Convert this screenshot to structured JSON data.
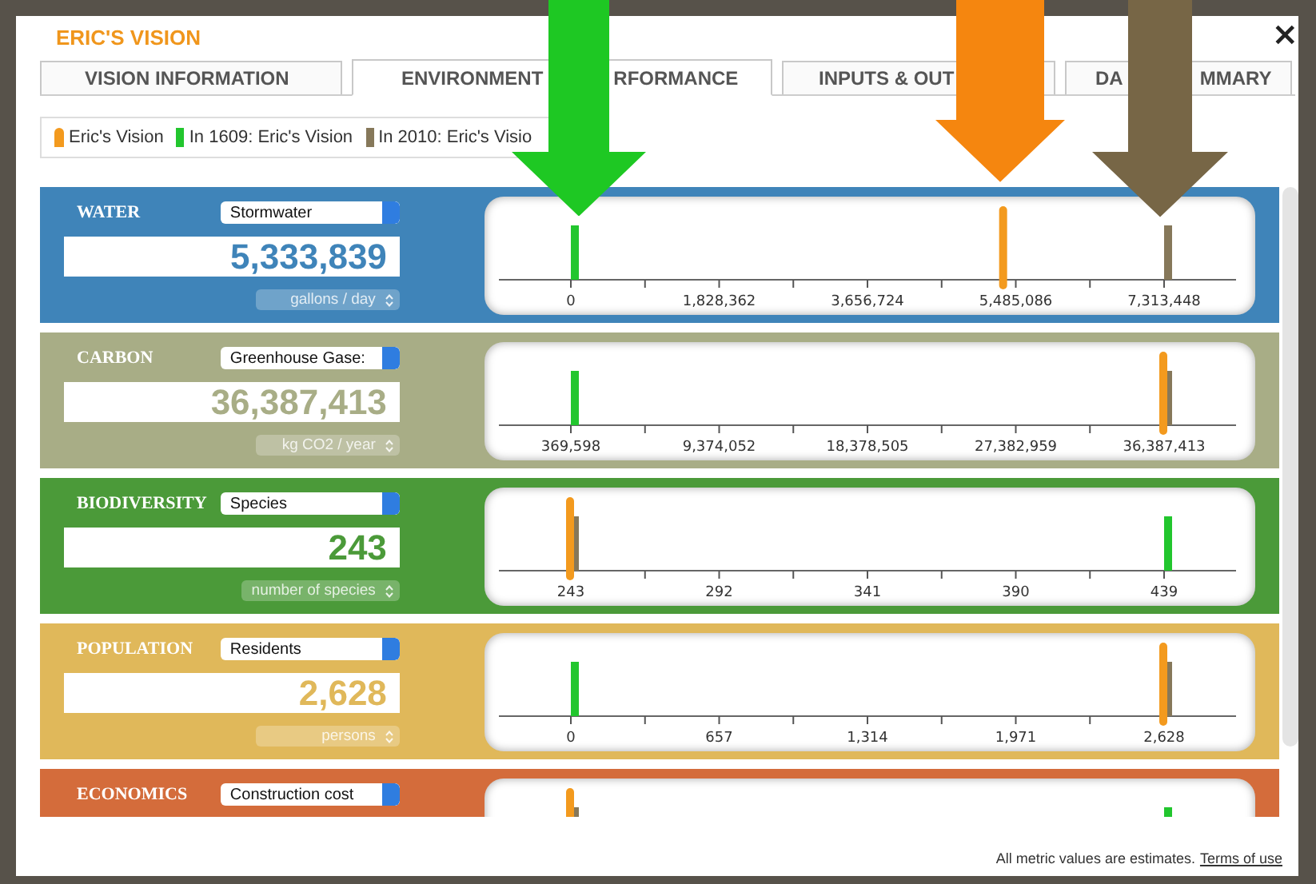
{
  "dialog": {
    "title": "ERIC'S VISION",
    "close": "×"
  },
  "tabs": [
    {
      "segments": [
        "VISION INFORMATION"
      ],
      "selected": false
    },
    {
      "segments": [
        "ENVIRONMENT",
        "RFORMANCE"
      ],
      "selected": true
    },
    {
      "segments": [
        "INPUTS & OUT"
      ],
      "selected": false
    },
    {
      "segments": [
        "DA",
        "MMARY"
      ],
      "selected": false
    }
  ],
  "legend": [
    {
      "label": "Eric's Vision",
      "kind": "pill",
      "color": "#f39a1e"
    },
    {
      "label": "In 1609: Eric's Vision",
      "kind": "bar",
      "color": "#22c62e"
    },
    {
      "label": "In 2010: Eric's Visio",
      "kind": "bar",
      "color": "#86785a"
    }
  ],
  "rows": [
    {
      "label": "WATER",
      "color": "#3f84b9",
      "metric": "Stormwater",
      "value": "5,333,839",
      "units": "gallons / day",
      "scale": [
        "0",
        "1,828,362",
        "3,656,724",
        "5,485,086",
        "7,313,448"
      ],
      "markers": [
        {
          "kind": "bar",
          "color": "#22c62e",
          "level": 0
        },
        {
          "kind": "bar",
          "color": "#86785a",
          "level": 1
        },
        {
          "kind": "pill",
          "color": "#f39a1e",
          "level": 0.73
        }
      ]
    },
    {
      "label": "CARBON",
      "color": "#a8ad86",
      "metric": "Greenhouse Gase:",
      "value": "36,387,413",
      "units": "kg CO2 / year",
      "scale": [
        "369,598",
        "9,374,052",
        "18,378,505",
        "27,382,959",
        "36,387,413"
      ],
      "markers": [
        {
          "kind": "bar",
          "color": "#22c62e",
          "level": 0
        },
        {
          "kind": "bar",
          "color": "#86785a",
          "level": 1
        },
        {
          "kind": "pill",
          "color": "#f39a1e",
          "level": 1
        }
      ]
    },
    {
      "label": "BIODIVERSITY",
      "color": "#4b9a39",
      "metric": "Species",
      "value": "243",
      "units": "number of species",
      "scale": [
        "243",
        "292",
        "341",
        "390",
        "439"
      ],
      "markers": [
        {
          "kind": "bar",
          "color": "#22c62e",
          "level": 1
        },
        {
          "kind": "bar",
          "color": "#86785a",
          "level": 0
        },
        {
          "kind": "pill",
          "color": "#f39a1e",
          "level": 0
        }
      ]
    },
    {
      "label": "POPULATION",
      "color": "#e0b85a",
      "metric": "Residents",
      "value": "2,628",
      "units": "persons",
      "scale": [
        "0",
        "657",
        "1,314",
        "1,971",
        "2,628"
      ],
      "markers": [
        {
          "kind": "bar",
          "color": "#22c62e",
          "level": 0
        },
        {
          "kind": "bar",
          "color": "#86785a",
          "level": 1
        },
        {
          "kind": "pill",
          "color": "#f39a1e",
          "level": 1
        }
      ]
    },
    {
      "label": "ECONOMICS",
      "color": "#d46c3b",
      "metric": "Construction cost",
      "markers": [
        {
          "kind": "bar",
          "color": "#22c62e",
          "level": 1
        },
        {
          "kind": "bar",
          "color": "#86785a",
          "level": 0
        },
        {
          "kind": "pill",
          "color": "#f39a1e",
          "level": 0
        }
      ]
    }
  ],
  "footer": {
    "note": "All metric values are estimates.",
    "link": "Terms of use"
  }
}
